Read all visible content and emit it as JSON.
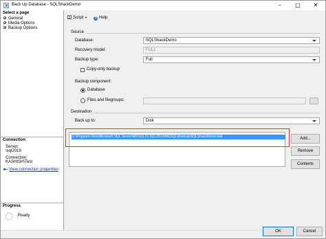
{
  "window": {
    "title": "Back Up Database - SQLShackDemo"
  },
  "left": {
    "select_page_header": "Select a page",
    "pages": [
      "General",
      "Media Options",
      "Backup Options"
    ],
    "connection_header": "Connection",
    "server_label": "Server:",
    "server_value": "\\sql2019",
    "connection_label": "Connection:",
    "connection_value": "KASHISH\\Test",
    "view_connection_link": "View connection properties",
    "progress_header": "Progress",
    "progress_status": "Ready"
  },
  "toolbar": {
    "script_label": "Script",
    "help_label": "Help"
  },
  "source": {
    "group_label": "Source",
    "database_label": "Database:",
    "database_value": "SQLShackDemo",
    "recovery_label": "Recovery model:",
    "recovery_value": "FULL",
    "backup_type_label": "Backup type:",
    "backup_type_value": "Full",
    "copy_only_label": "Copy-only backup",
    "component_label": "Backup component:",
    "component_database": "Database",
    "component_files": "Files and filegroups:"
  },
  "destination": {
    "group_label": "Destination",
    "backup_to_label": "Back up to:",
    "backup_to_value": "Disk",
    "paths": [
      "C:\\Program Files\\Microsoft SQL Server\\MSSQL15.SQL2019\\MSSQL\\Backup\\SQLShackDemo.bak"
    ],
    "add_button": "Add...",
    "remove_button": "Remove",
    "contents_button": "Contents"
  },
  "footer": {
    "ok_button": "OK",
    "cancel_button": "Cancel"
  },
  "colors": {
    "selection": "#3399ff",
    "highlight_box": "#d9342b",
    "link": "#0033cc"
  }
}
